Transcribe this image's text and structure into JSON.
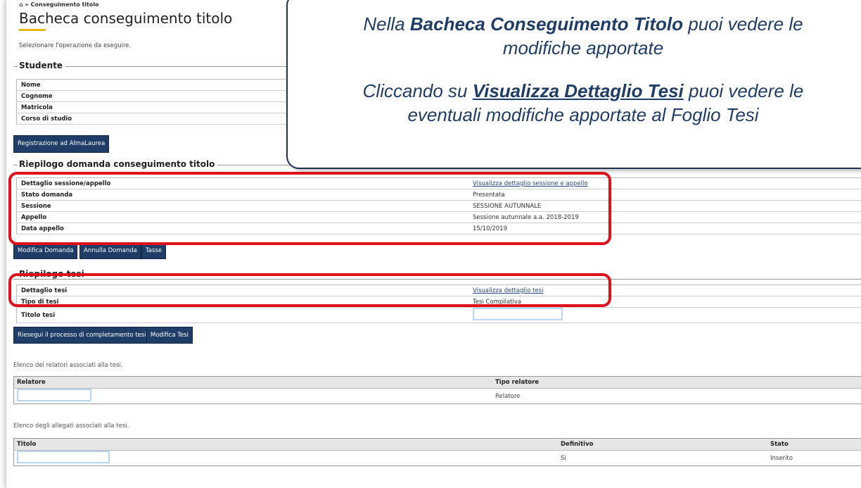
{
  "breadcrumb": {
    "home_icon": "home-icon",
    "separator": "»",
    "current": "Conseguimento titolo"
  },
  "page": {
    "title": "Bacheca conseguimento titolo",
    "subtitle": "Selezionare l'operazione da eseguire."
  },
  "student": {
    "legend": "Studente",
    "rows": [
      {
        "label": "Nome",
        "value": ""
      },
      {
        "label": "Cognome",
        "value": ""
      },
      {
        "label": "Matricola",
        "value": ""
      },
      {
        "label": "Corso di studio",
        "value": ""
      }
    ],
    "almalaurea_button": "Registrazione ad AlmaLaurea"
  },
  "summary": {
    "legend": "Riepilogo domanda conseguimento titolo",
    "rows": [
      {
        "label": "Dettaglio sessione/appello",
        "value": "Visualizza dettaglio sessione e appello"
      },
      {
        "label": "Stato domanda",
        "value": "Presentata"
      },
      {
        "label": "Sessione",
        "value": "SESSIONE AUTUNNALE"
      },
      {
        "label": "Appello",
        "value": "Sessione autunnale a.a. 2018-2019"
      },
      {
        "label": "Data appello",
        "value": "15/10/2019"
      }
    ],
    "buttons": [
      "Modifica Domanda",
      "Annulla Domanda",
      "Tasse"
    ]
  },
  "thesis": {
    "legend": "Riepilogo tesi",
    "rows": [
      {
        "label": "Dettaglio tesi",
        "value": "Visualizza dettaglio tesi"
      },
      {
        "label": "Tipo di tesi",
        "value": "Tesi Compilativa"
      },
      {
        "label": "Titolo tesi",
        "value": ""
      }
    ],
    "buttons": [
      "Riesegui il processo di completamento tesi",
      "Modifica Tesi"
    ]
  },
  "relatori": {
    "caption": "Elenco dei relatori associati alla tesi.",
    "headers": [
      "Relatore",
      "Tipo relatore"
    ],
    "rows": [
      [
        "",
        "Relatore"
      ]
    ]
  },
  "allegati": {
    "caption": "Elenco degli allegati associati alla tesi.",
    "headers": [
      "Titolo",
      "Definitivo",
      "Stato"
    ],
    "rows": [
      [
        "",
        "Sì",
        "Inserito"
      ]
    ]
  },
  "callout": {
    "line1_pre": "Nella ",
    "line1_bold": "Bacheca Conseguimento Titolo",
    "line1_post": " puoi vedere le",
    "line2": "modifiche apportate",
    "line3_pre": "Cliccando su ",
    "line3_link": "Visualizza Dettaglio Tesi",
    "line3_post": " puoi vedere le",
    "line4": "eventuali modifiche apportate al Foglio Tesi"
  },
  "colors": {
    "accent_button": "#1f3d66",
    "highlight": "#e0111a",
    "underline": "#e8b71a",
    "callout_text": "#1f3d66"
  }
}
